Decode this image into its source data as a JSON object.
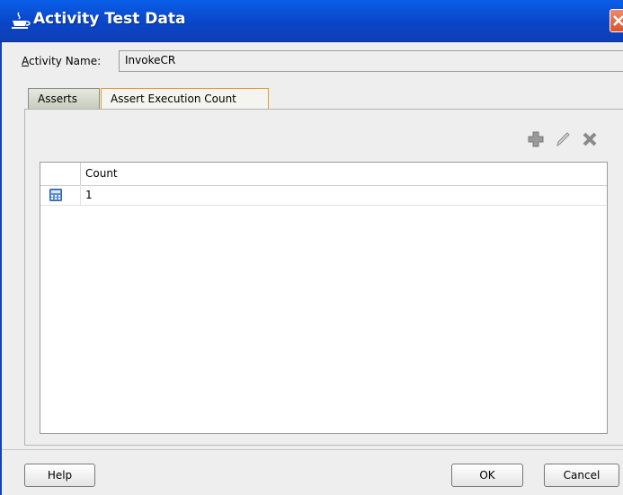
{
  "window": {
    "title": "Activity Test Data"
  },
  "activity": {
    "label_prefix": "",
    "label_accel": "A",
    "label_rest": "ctivity Name:",
    "value": "InvokeCR"
  },
  "tabs": [
    {
      "label": "Asserts",
      "selected": false
    },
    {
      "label": "Assert Execution Count",
      "selected": true
    }
  ],
  "toolbar": {
    "icons": [
      "add-icon",
      "edit-icon",
      "delete-icon"
    ]
  },
  "table": {
    "columns": [
      "Count"
    ],
    "rows": [
      {
        "icon": "calculator-icon",
        "count": "1"
      }
    ]
  },
  "buttons": {
    "help": "Help",
    "ok": "OK",
    "cancel": "Cancel"
  },
  "colors": {
    "title_bar": "#0a45c8",
    "selected_tab_border": "#e0a030"
  }
}
